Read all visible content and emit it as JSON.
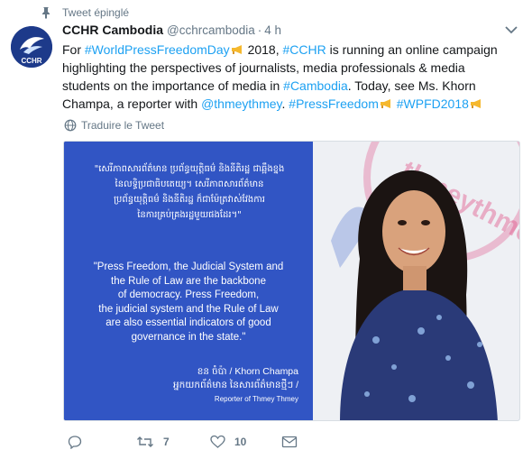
{
  "pinned": {
    "label": "Tweet épinglé"
  },
  "account": {
    "name": "CCHR Cambodia",
    "handle": "@cchrcambodia",
    "separator": "·",
    "time": "4 h",
    "avatar_text": "CCHR"
  },
  "tweet": {
    "line1": {
      "pre": "For ",
      "tag1": "#WorldPressFreedomDay",
      "post": " 2018, ",
      "tag2": "#CCHR",
      "rest": " is running an online campaign"
    },
    "line2": "highlighting the perspectives of  journalists, media professionals & media",
    "line3": {
      "pre": "students on the importance of media in ",
      "tag": "#Cambodia",
      "rest": ". Today, see Ms. Khorn"
    },
    "line4": {
      "pre": "Champa, a reporter with ",
      "mention": "@thmeythmey",
      "mid": ". ",
      "tag1": "#PressFreedom",
      "mid2": " ",
      "tag2": "#WPFD2018"
    }
  },
  "translate": {
    "label": "Traduire le Tweet"
  },
  "media": {
    "khmer_quote": [
      "\"សេរីភាពសារព័ត៌មាន ប្រព័ន្ធយុត្តិធម៌ និងនីតិរដ្ឋ ជាឆ្អឹងខ្នង",
      "នៃលទ្ធិប្រជាធិបតេយ្យ។ សេរីភាពសារព័ត៌មាន",
      "ប្រព័ន្ធយុត្តិធម៌ និងនីតិរដ្ឋ ក៏ជាម៉ែត្រវាស់វែងការ",
      "នៃការគ្រប់គ្រងរដ្ឋមួយផងដែរ។\""
    ],
    "english_quote": [
      "\"Press Freedom, the Judicial System and",
      "the Rule of Law are the backbone",
      "of democracy. Press Freedom,",
      "the judicial system and the Rule of Law",
      "are also essential indicators of good",
      "governance in the state.\""
    ],
    "signature_name": "ខន ចំប៉ា / Khorn Champa",
    "signature_role_kh": "អ្នកយកព័ត៌មាន នៃសារព័ត៌មានថ្មីៗ /",
    "signature_role_en": "Reporter of Thmey Thmey",
    "photo_bg_text": "thmeythmey.com"
  },
  "actions": {
    "reply_count": "",
    "retweet_count": "7",
    "like_count": "10"
  },
  "colors": {
    "link": "#1da1f2",
    "muted": "#657786",
    "panel": "#3155c4"
  }
}
